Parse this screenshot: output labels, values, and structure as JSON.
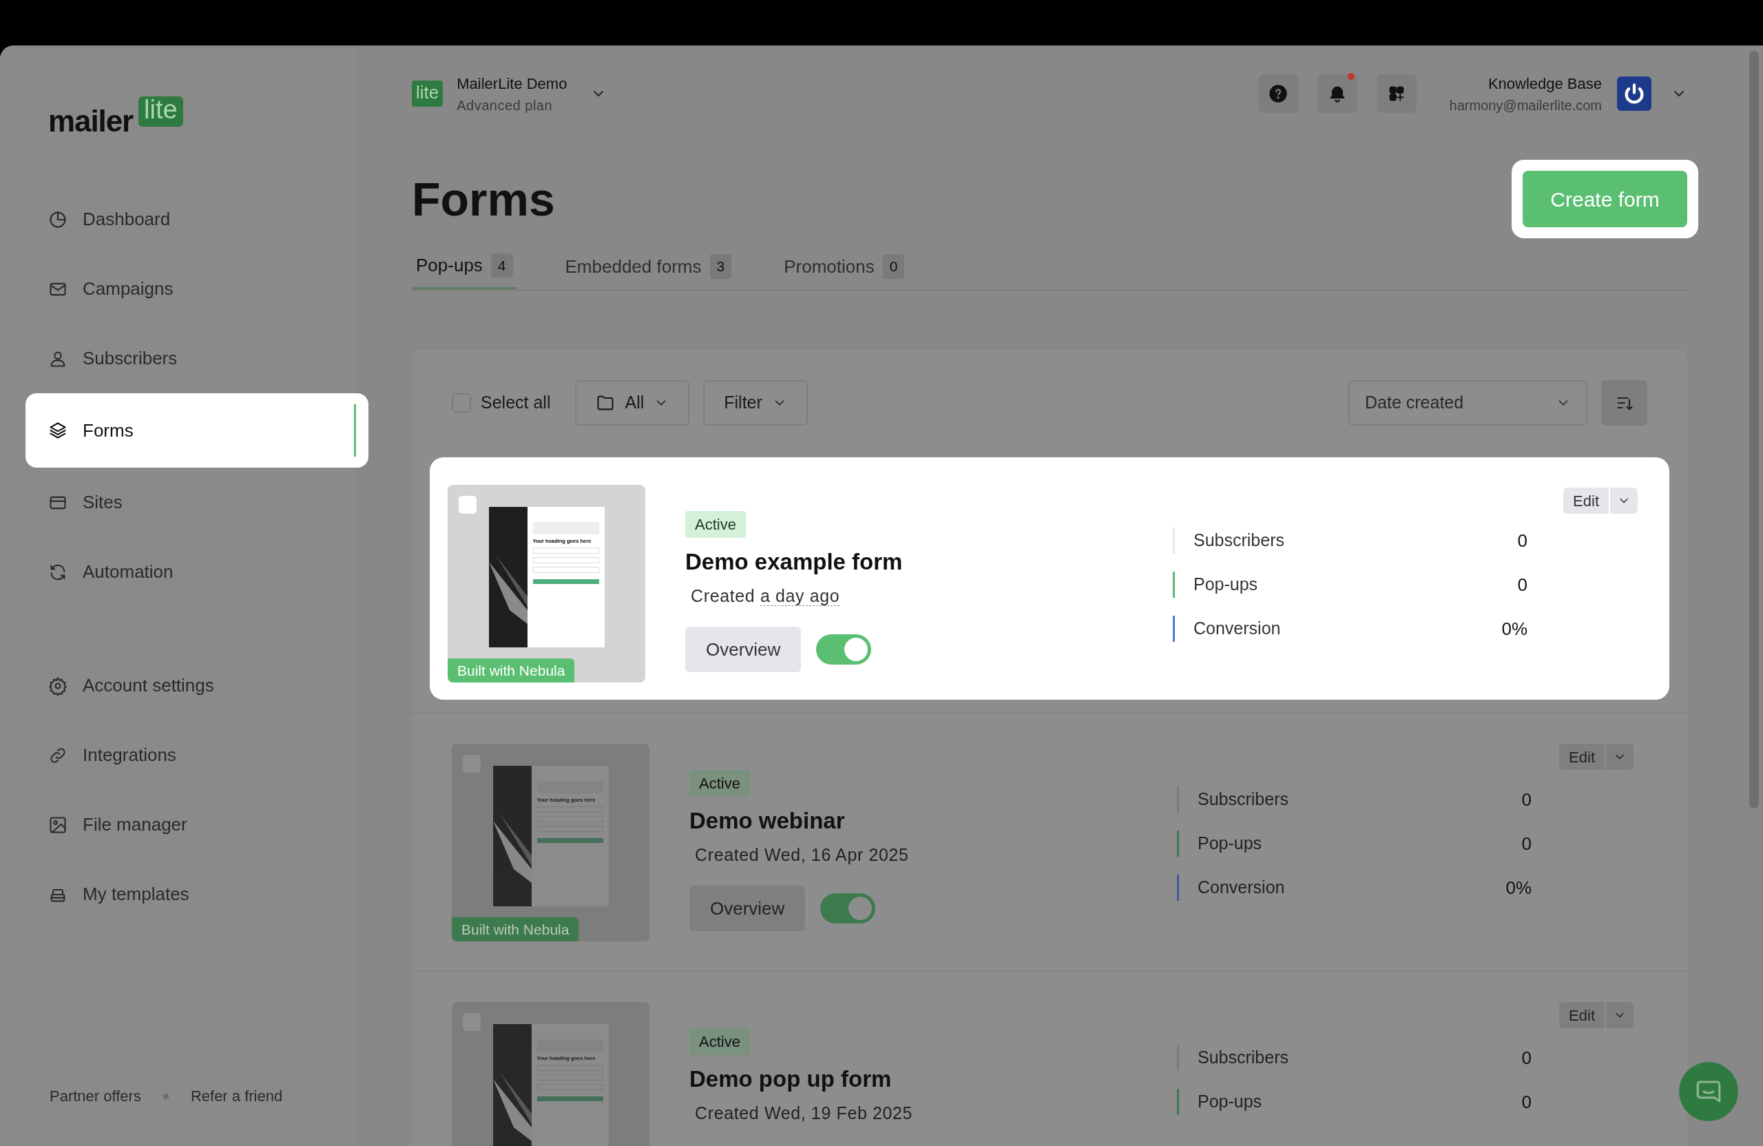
{
  "sidebar": {
    "logo": {
      "word": "mailer",
      "badge": "lite"
    },
    "nav_groups": [
      [
        {
          "label": "Dashboard",
          "selected": false
        },
        {
          "label": "Campaigns",
          "selected": false
        },
        {
          "label": "Subscribers",
          "selected": false
        },
        {
          "label": "Forms",
          "selected": true
        },
        {
          "label": "Sites",
          "selected": false
        },
        {
          "label": "Automation",
          "selected": false
        }
      ],
      [
        {
          "label": "Account settings",
          "selected": false
        },
        {
          "label": "Integrations",
          "selected": false
        },
        {
          "label": "File manager",
          "selected": false
        },
        {
          "label": "My templates",
          "selected": false
        }
      ]
    ],
    "footer_links": [
      "Partner offers",
      "Refer a friend"
    ]
  },
  "header": {
    "workspace_badge": "lite",
    "workspace_name": "MailerLite Demo",
    "plan": "Advanced plan",
    "notification_unread": true,
    "user_name": "Knowledge Base",
    "user_email": "harmony@mailerlite.com"
  },
  "page": {
    "title": "Forms",
    "create_button": {
      "label": "Create form",
      "highlighted": true
    }
  },
  "tabs": [
    {
      "label": "Pop-ups",
      "count": "4",
      "selected": true
    },
    {
      "label": "Embedded forms",
      "count": "3",
      "selected": false
    },
    {
      "label": "Promotions",
      "count": "0",
      "selected": false
    }
  ],
  "toolbar": {
    "select_all": {
      "label": "Select all",
      "checked": false
    },
    "folder": "All",
    "filter": "Filter",
    "sort": "Date created"
  },
  "forms": [
    {
      "highlighted": true,
      "checked": false,
      "status": "Active",
      "name": "Demo example form",
      "created_prefix": "Created",
      "created": "a day ago",
      "overview": "Overview",
      "enabled": true,
      "builder_badge": "Built with Nebula",
      "preview_heading": "Your heading goes here",
      "edit": "Edit",
      "stats": [
        {
          "label": "Subscribers",
          "value": "0",
          "color": "#e5e7eb"
        },
        {
          "label": "Pop-ups",
          "value": "0",
          "color": "#5bbf72"
        },
        {
          "label": "Conversion",
          "value": "0%",
          "color": "#4a7bd8"
        }
      ]
    },
    {
      "highlighted": false,
      "checked": false,
      "status": "Active",
      "name": "Demo webinar",
      "created_prefix": "Created",
      "created": "Wed, 16 Apr 2025",
      "overview": "Overview",
      "enabled": true,
      "builder_badge": "Built with Nebula",
      "preview_heading": "Your heading goes here",
      "edit": "Edit",
      "stats": [
        {
          "label": "Subscribers",
          "value": "0",
          "color": "#7a7a7a"
        },
        {
          "label": "Pop-ups",
          "value": "0",
          "color": "#3d7a4d"
        },
        {
          "label": "Conversion",
          "value": "0%",
          "color": "#3b5a9a"
        }
      ]
    },
    {
      "highlighted": false,
      "checked": false,
      "status": "Active",
      "name": "Demo pop up form",
      "created_prefix": "Created",
      "created": "Wed, 19 Feb 2025",
      "preview_heading": "Your heading goes here",
      "edit": "Edit",
      "stats": [
        {
          "label": "Subscribers",
          "value": "0",
          "color": "#7a7a7a"
        },
        {
          "label": "Pop-ups",
          "value": "0",
          "color": "#3d7a4d"
        }
      ]
    }
  ]
}
